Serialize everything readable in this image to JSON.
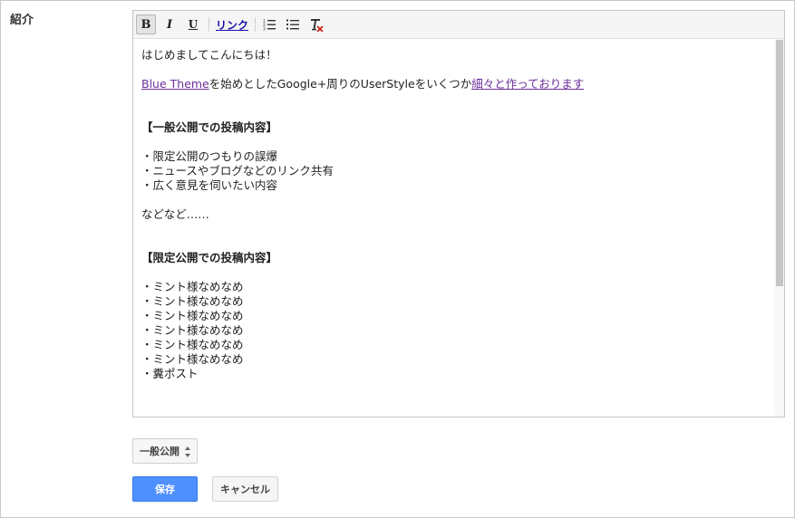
{
  "section": {
    "label": "紹介"
  },
  "toolbar": {
    "bold_label": "B",
    "italic_label": "I",
    "underline_label": "U",
    "link_label": "リンク",
    "icons": [
      "bold-icon",
      "italic-icon",
      "underline-icon",
      "numbered-list-icon",
      "bulleted-list-icon",
      "clear-formatting-icon"
    ]
  },
  "content": {
    "greeting": "はじめましてこんにちは！",
    "intro_link1": "Blue Theme",
    "intro_mid": "を始めとしたGoogle+周りのUserStyleをいくつか",
    "intro_link2": "細々と作っております",
    "heading_public": "【一般公開での投稿内容】",
    "public_items": [
      "・限定公開のつもりの誤爆",
      "・ニュースやブログなどのリンク共有",
      "・広く意見を伺いたい内容"
    ],
    "etc": "などなど……",
    "heading_limited": "【限定公開での投稿内容】",
    "limited_items": [
      "・ミント様なめなめ",
      "・ミント様なめなめ",
      "・ミント様なめなめ",
      "・ミント様なめなめ",
      "・ミント様なめなめ",
      "・ミント様なめなめ",
      "・糞ポスト"
    ]
  },
  "privacy_select": {
    "value": "一般公開"
  },
  "actions": {
    "save_label": "保存",
    "cancel_label": "キャンセル"
  },
  "colors": {
    "primary_button": "#4d90fe",
    "link_visited": "#6b2f9b",
    "link_toolbar": "#1a0dab"
  }
}
